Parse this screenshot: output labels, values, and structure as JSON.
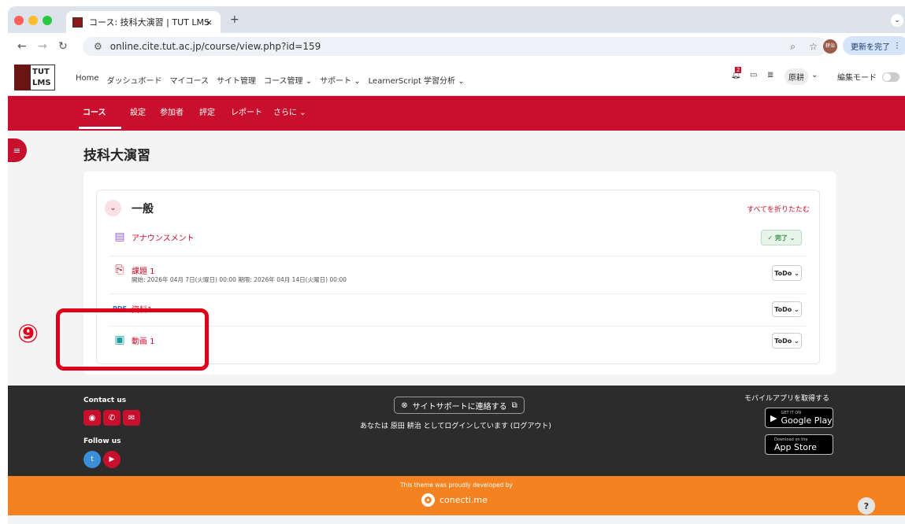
{
  "browser": {
    "tab_title": "コース: 技科大演習 | TUT LMS",
    "tab_close": "×",
    "new_tab": "+",
    "url": "online.cite.tut.ac.jp/course/view.php?id=159",
    "update_button": "更新を完了",
    "profile_initial": "耕治"
  },
  "site": {
    "logo_text_1": "TUT",
    "logo_text_2": "LMS",
    "menu": [
      "Home",
      "ダッシュボード",
      "マイコース",
      "サイト管理",
      "コース管理 ⌄",
      "サポート ⌄",
      "LearnerScript 学習分析 ⌄"
    ],
    "notification_count": "2",
    "user_name": "原耕",
    "edit_mode_label": "編集モード"
  },
  "course_nav": {
    "items": [
      "コース",
      "設定",
      "参加者",
      "評定",
      "レポート",
      "さらに ⌄"
    ],
    "active": "コース"
  },
  "course": {
    "title": "技科大演習",
    "section_title": "一般",
    "collapse_all": "すべてを折りたたむ",
    "activities": [
      {
        "icon": "forum-icon",
        "name": "アナウンスメント",
        "status": "✓ 完了 ⌄",
        "status_color": "#2e8b3e"
      },
      {
        "icon": "assignment-icon",
        "name": "課題 1",
        "dates": "開始: 2026年 04月 7日(火曜日) 00:00   期限: 2026年 04月 14日(火曜日) 00:00",
        "status": "ToDo ⌄"
      },
      {
        "icon": "pdf-icon",
        "name": "資料1",
        "status": "ToDo ⌄"
      },
      {
        "icon": "video-icon",
        "name": "動画 1",
        "status": "ToDo ⌄"
      }
    ]
  },
  "footer": {
    "contact_us": "Contact us",
    "follow_us": "Follow us",
    "support_button": "サイトサポートに連絡する",
    "login_info": "あなたは 原田 耕治 としてログインしています (ログアウト)",
    "get_app": "モバイルアプリを取得する",
    "google_small": "GET IT ON",
    "google_big": "Google Play",
    "apple_small": "Download on the",
    "apple_big": "App Store"
  },
  "theme_footer": {
    "developed_by": "This theme was proudly developed by",
    "brand": "conecti.me"
  },
  "annotation": {
    "label": "⑨"
  },
  "colors": {
    "accent": "#c8102e",
    "orange": "#f58220",
    "annotation": "#e0001b"
  }
}
